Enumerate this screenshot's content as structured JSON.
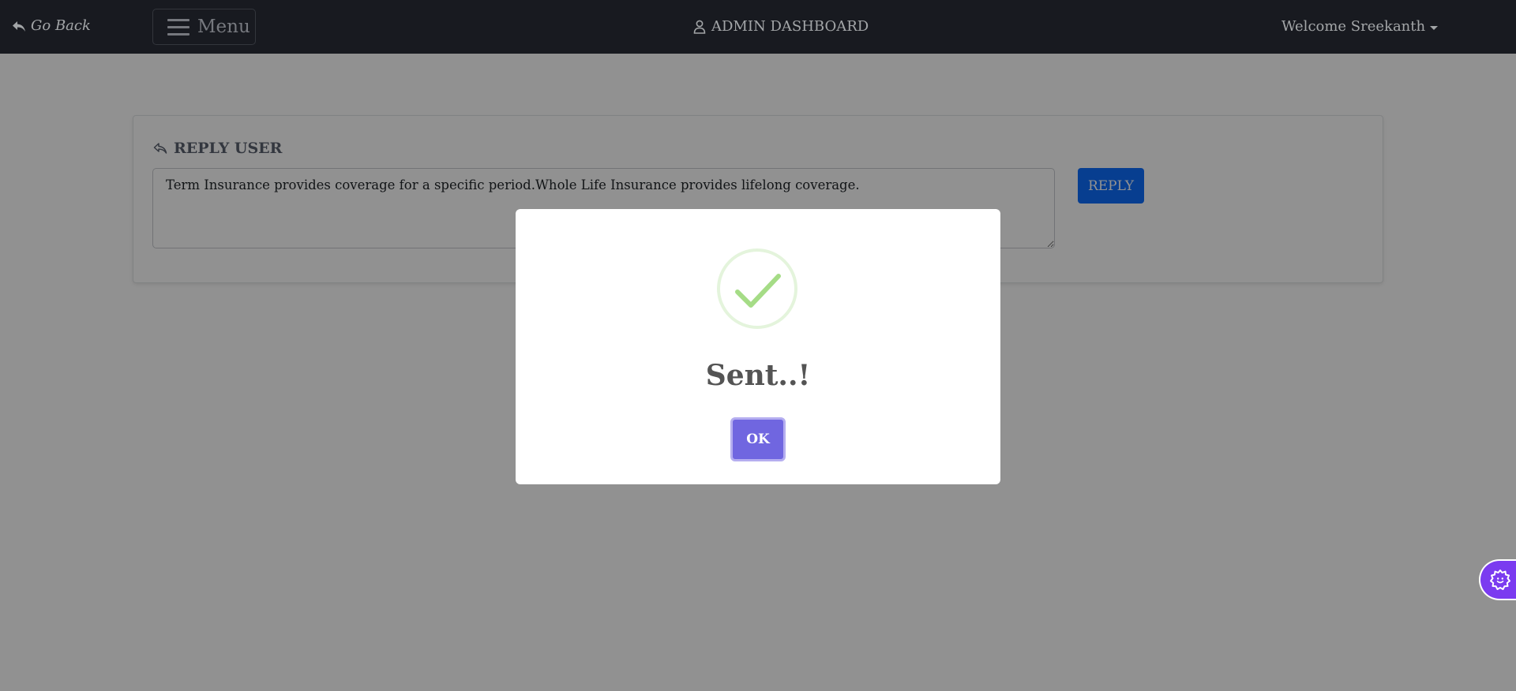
{
  "navbar": {
    "go_back_label": "Go Back",
    "menu_label": "Menu",
    "title": "ADMIN DASHBOARD",
    "welcome_text": "Welcome Sreekanth"
  },
  "reply_card": {
    "title": "REPLY USER",
    "message": "Term Insurance provides coverage for a specific period.Whole Life Insurance provides lifelong coverage.",
    "reply_button": "REPLY"
  },
  "modal": {
    "title": "Sent..!",
    "ok_button": "OK",
    "icon": "success-check-icon"
  },
  "colors": {
    "navbar_bg": "#23262f",
    "reply_button": "#0d6efd",
    "ok_button": "#7066e0",
    "success_check": "#a5dc86",
    "widget_bg": "#7b3bf0"
  }
}
